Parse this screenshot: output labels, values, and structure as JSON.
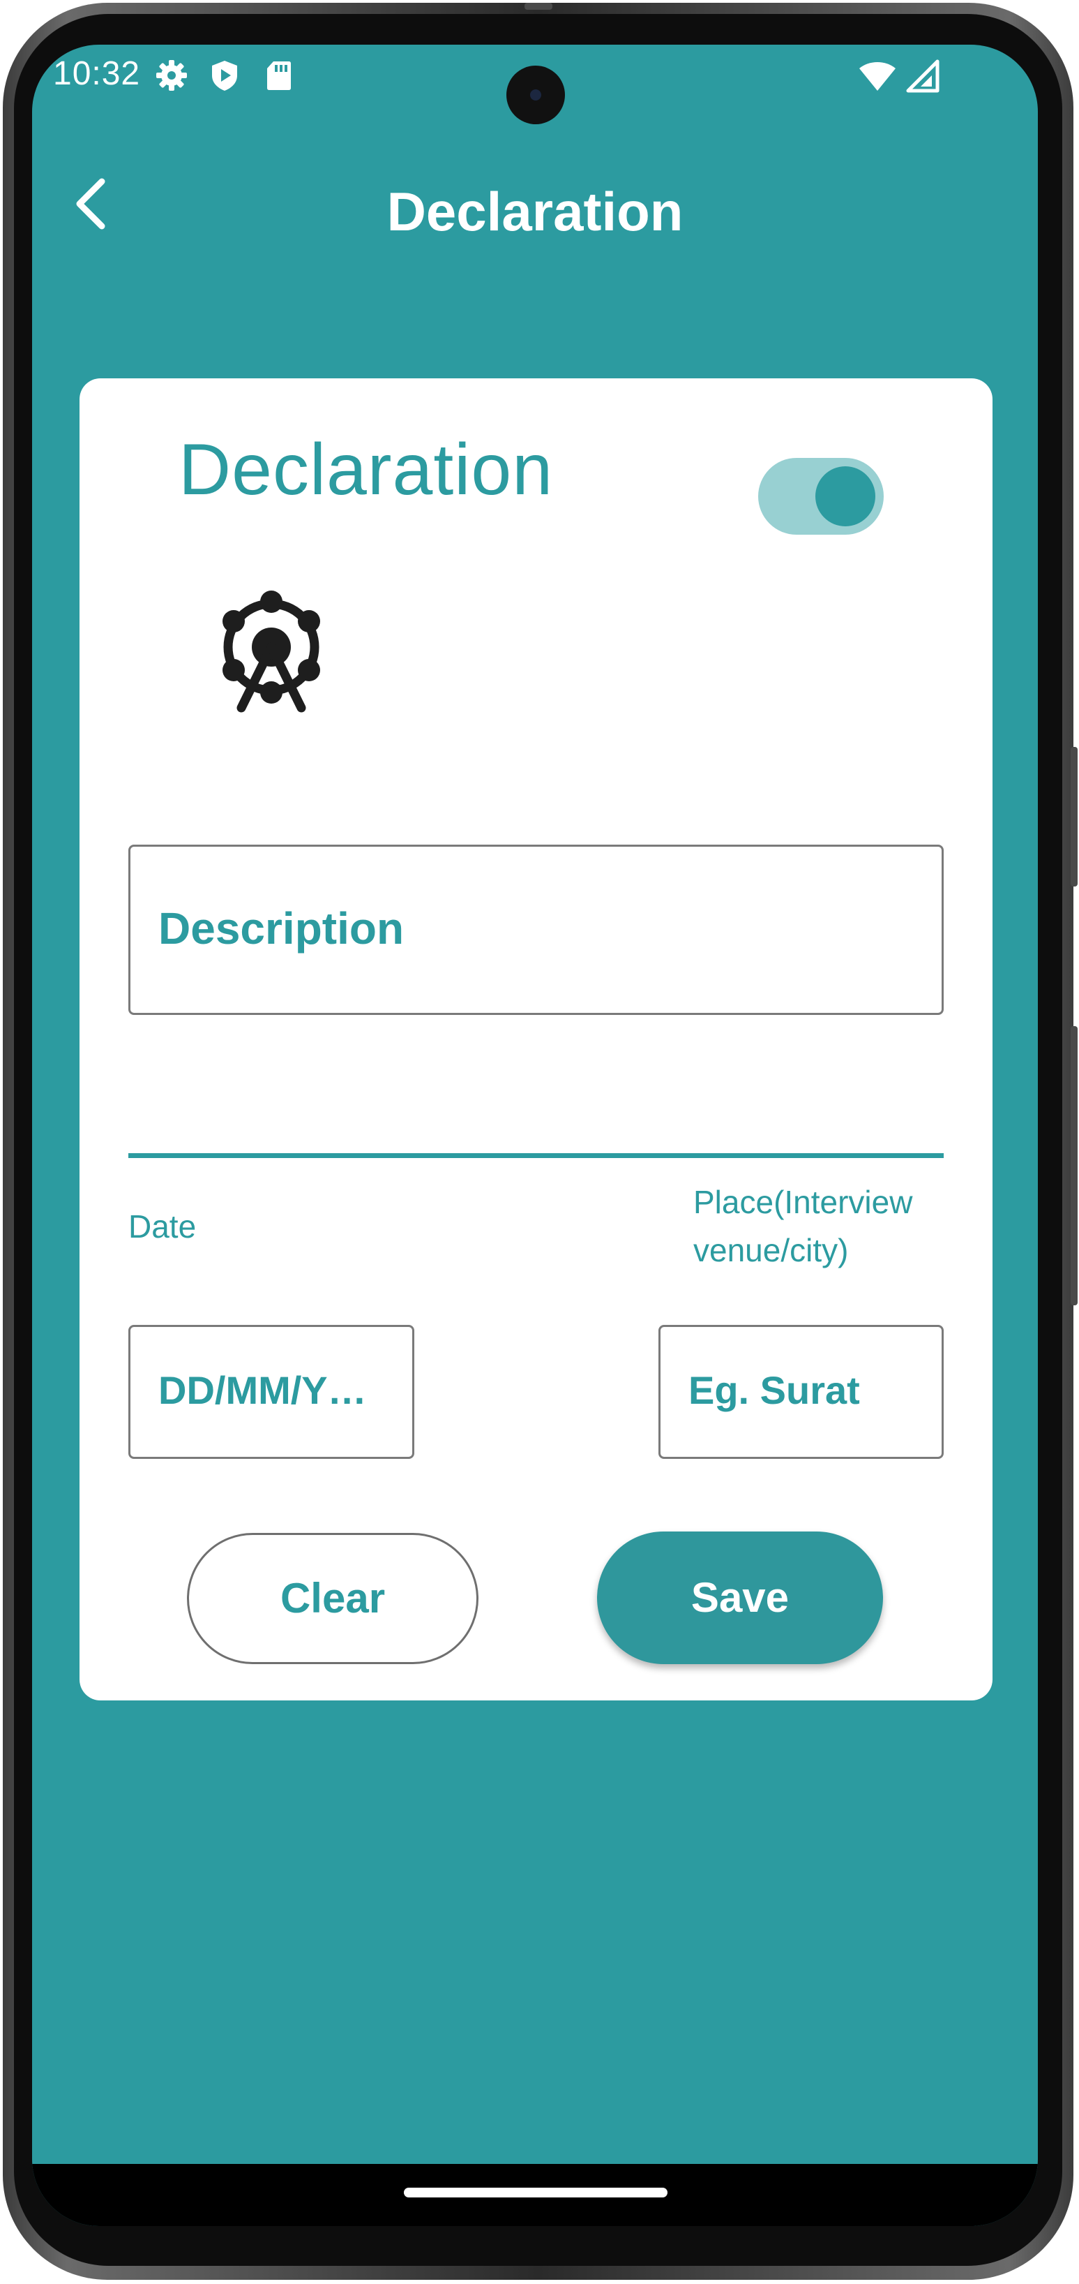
{
  "status_bar": {
    "time": "10:32",
    "left_icons": [
      "settings-icon",
      "shield-play-icon",
      "sd-card-icon"
    ],
    "right_icons": [
      "wifi-icon",
      "cell-signal-icon"
    ]
  },
  "app_bar": {
    "title": "Declaration",
    "back_icon": "chevron-left-icon"
  },
  "card": {
    "title": "Declaration",
    "toggle_on": true,
    "illustration_icon": "ferris-wheel-icon",
    "description_field": {
      "placeholder": "Description",
      "value": ""
    },
    "date_label": "Date",
    "place_label_line1": "Place(Interview",
    "place_label_line2": "venue/city)",
    "date_field": {
      "placeholder": "DD/MM/Y…",
      "value": ""
    },
    "place_field": {
      "placeholder": "Eg. Surat",
      "value": ""
    },
    "clear_label": "Clear",
    "save_label": "Save"
  },
  "colors": {
    "primary": "#2c9ba0",
    "toggle_track": "#98d0d2",
    "card_background": "#ffffff",
    "outline": "#7a7a7a"
  }
}
